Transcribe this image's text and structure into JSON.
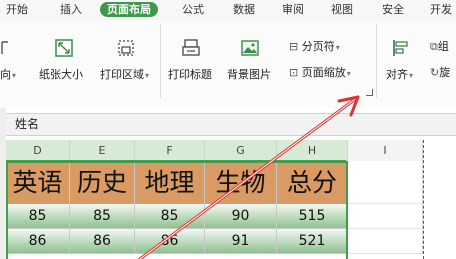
{
  "menu_tabs": [
    "开始",
    "插入",
    "页面布局",
    "公式",
    "数据",
    "审阅",
    "视图",
    "安全",
    "开发"
  ],
  "ribbon": {
    "orientation": "向",
    "paper_size": "纸张大小",
    "print_area": "打印区域",
    "print_titles": "打印标题",
    "background": "背景图片",
    "page_break": "分页符",
    "page_scaling": "页面缩放",
    "align": "对齐",
    "combine": "组",
    "rotate": "旋"
  },
  "name_box": "姓名",
  "columns": [
    "D",
    "E",
    "F",
    "G",
    "H",
    "I"
  ],
  "subjects": [
    "英语",
    "历史",
    "地理",
    "生物",
    "总分"
  ],
  "rows": [
    [
      "85",
      "85",
      "85",
      "90",
      "515"
    ],
    [
      "86",
      "86",
      "86",
      "91",
      "521"
    ]
  ],
  "colors": {
    "accent": "#3c9a4a",
    "header_fill": "#d99a63",
    "arrow": "#e03131"
  }
}
